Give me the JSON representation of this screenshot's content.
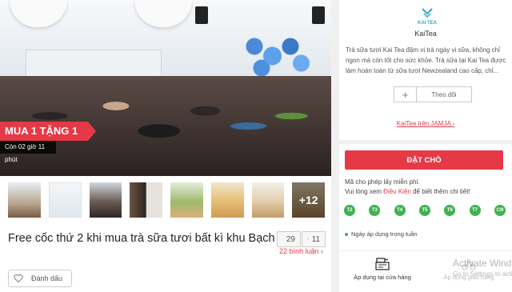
{
  "promo": {
    "badge": "MUA 1 TẶNG 1",
    "countdown": "Còn 02 giờ 11 phút"
  },
  "gallery": {
    "more_count": "+12"
  },
  "deal": {
    "title": "Free cốc thứ 2 khi mua trà sữa tươi bất kì khu Bạch Mai",
    "upvotes": "29",
    "downvotes": "11",
    "comments": "22 bình luận ›",
    "save_label": "Đánh dấu"
  },
  "store": {
    "logo_text": "KAI TEA",
    "name": "KaiTea",
    "description": "Trà sữa tươi Kai Tea đậm vị trà ngày vị sữa, không chỉ ngon mà còn tốt cho sức khỏe. Trà sữa tại Kai Tea được làm hoàn toàn từ sữa tươi Newzealand cao cấp, chỉ...",
    "follow_label": "Theo dõi",
    "jamja_link": "KaiTea trên JAMJA ›"
  },
  "booking": {
    "button_label": "ĐẶT CHỖ",
    "note_line1": "Mã cho phép lấy miễn phí.",
    "note_line2_prefix": "Vui lòng xem ",
    "note_line2_link": "Điều Kiện",
    "note_line2_suffix": " để biết thêm chi tiết!",
    "days": [
      "T2",
      "T3",
      "T4",
      "T5",
      "T6",
      "T7",
      "CN"
    ],
    "apply_note": "Ngày áp dụng trong tuần",
    "channel_store": "Áp dụng tại cửa hàng",
    "channel_delivery": "Áp dụng giao hàng"
  },
  "watermark": {
    "line1": "Activate Windows",
    "line2": "Go to Settings to activate"
  },
  "colors": {
    "accent": "#e53946",
    "day_green": "#3fb34f"
  }
}
